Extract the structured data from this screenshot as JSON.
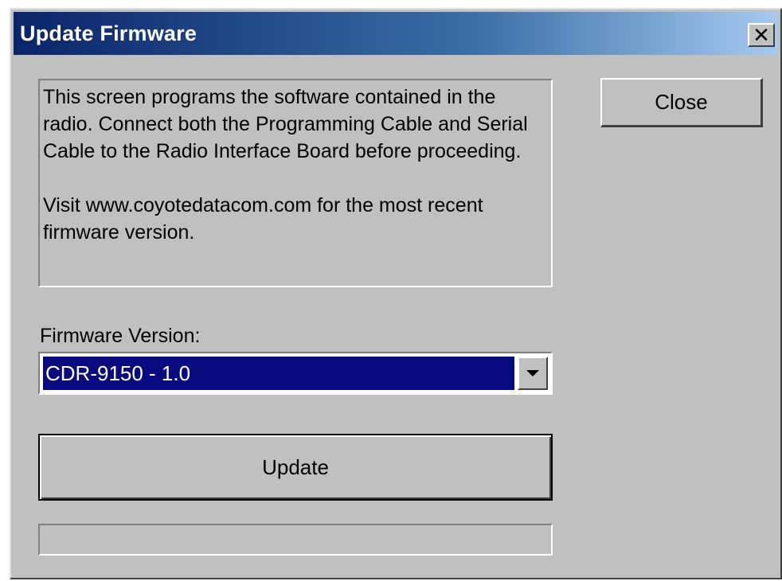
{
  "window": {
    "title": "Update Firmware",
    "close_glyph": "✕"
  },
  "info": {
    "paragraph1": "This screen programs the software contained in the radio. Connect both the Programming Cable and Serial Cable to the Radio Interface Board before proceeding.",
    "paragraph2": "Visit www.coyotedatacom.com for the most recent firmware version."
  },
  "close_button": {
    "label": "Close"
  },
  "firmware": {
    "label": "Firmware Version:",
    "selected": "CDR-9150 - 1.0"
  },
  "update_button": {
    "label": "Update"
  },
  "progress": {
    "fraction": 0
  },
  "colors": {
    "title_bar_start": "#0a246a",
    "title_bar_end": "#a6caf0",
    "face": "#c0c0c0",
    "selection": "#0a0a80"
  },
  "icons": {
    "window_close": "close-icon",
    "dropdown": "chevron-down-icon"
  }
}
